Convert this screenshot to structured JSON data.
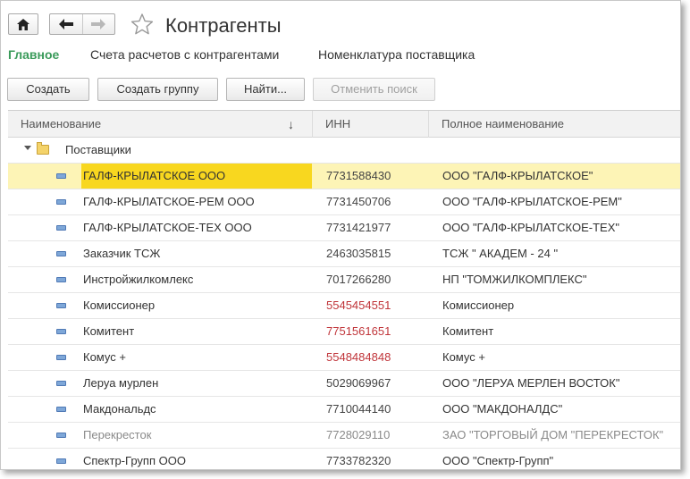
{
  "window": {
    "title": "Контрагенты"
  },
  "tabs": [
    {
      "label": "Главное",
      "active": true
    },
    {
      "label": "Счета расчетов с контрагентами",
      "active": false
    },
    {
      "label": "Номенклатура поставщика",
      "active": false
    }
  ],
  "toolbar": {
    "create": "Создать",
    "create_group": "Создать группу",
    "find": "Найти...",
    "cancel_search": "Отменить поиск"
  },
  "table": {
    "columns": [
      "Наименование",
      "ИНН",
      "Полное наименование"
    ],
    "sort_indicator": "↓",
    "group": "Поставщики",
    "rows": [
      {
        "name": "ГАЛФ-КРЫЛАТСКОЕ ООО",
        "inn": "7731588430",
        "full": "ООО \"ГАЛФ-КРЫЛАТСКОЕ\"",
        "selected": true,
        "inn_red": false,
        "muted": false
      },
      {
        "name": "ГАЛФ-КРЫЛАТСКОЕ-РЕМ ООО",
        "inn": "7731450706",
        "full": "ООО \"ГАЛФ-КРЫЛАТСКОЕ-РЕМ\"",
        "selected": false,
        "inn_red": false,
        "muted": false
      },
      {
        "name": "ГАЛФ-КРЫЛАТСКОЕ-ТЕХ ООО",
        "inn": "7731421977",
        "full": "ООО \"ГАЛФ-КРЫЛАТСКОЕ-ТЕХ\"",
        "selected": false,
        "inn_red": false,
        "muted": false
      },
      {
        "name": "Заказчик ТСЖ",
        "inn": "2463035815",
        "full": "ТСЖ  \" АКАДЕМ - 24 \"",
        "selected": false,
        "inn_red": false,
        "muted": false
      },
      {
        "name": "Инстройжилкомлекс",
        "inn": "7017266280",
        "full": "НП \"ТОМЖИЛКОМПЛЕКС\"",
        "selected": false,
        "inn_red": false,
        "muted": false
      },
      {
        "name": "Комиссионер",
        "inn": "5545454551",
        "full": "Комиссионер",
        "selected": false,
        "inn_red": true,
        "muted": false
      },
      {
        "name": "Комитент",
        "inn": "7751561651",
        "full": "Комитент",
        "selected": false,
        "inn_red": true,
        "muted": false
      },
      {
        "name": "Комус +",
        "inn": "5548484848",
        "full": "Комус +",
        "selected": false,
        "inn_red": true,
        "muted": false
      },
      {
        "name": "Леруа мурлен",
        "inn": "5029069967",
        "full": "ООО \"ЛЕРУА МЕРЛЕН ВОСТОК\"",
        "selected": false,
        "inn_red": false,
        "muted": false
      },
      {
        "name": "Макдональдс",
        "inn": "7710044140",
        "full": "ООО \"МАКДОНАЛДС\"",
        "selected": false,
        "inn_red": false,
        "muted": false
      },
      {
        "name": "Перекресток",
        "inn": "7728029110",
        "full": "ЗАО \"ТОРГОВЫЙ ДОМ \"ПЕРЕКРЕСТОК\"",
        "selected": false,
        "inn_red": false,
        "muted": true
      },
      {
        "name": "Спектр-Групп ООО",
        "inn": "7733782320",
        "full": "ООО \"Спектр-Групп\"",
        "selected": false,
        "inn_red": false,
        "muted": false
      }
    ]
  },
  "colors": {
    "active_tab": "#3b9b5b",
    "selected_row": "#fdf4b6",
    "selected_cell": "#f8d71f",
    "red_text": "#c0353a"
  }
}
